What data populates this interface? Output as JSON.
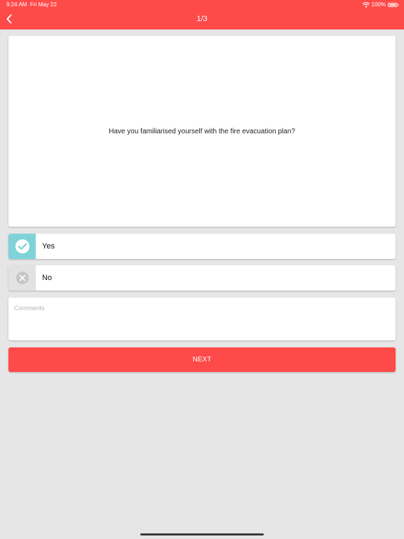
{
  "status_bar": {
    "time": "9:24 AM",
    "date": "Fri May 22",
    "battery": "100%"
  },
  "nav": {
    "title": "1/3",
    "back_icon": "chevron-left-icon"
  },
  "question": {
    "text": "Have you familiarised yourself with the fire evacuation plan?"
  },
  "options": [
    {
      "label": "Yes",
      "icon": "check-circle-icon",
      "selected": true,
      "color": "#7fd3d8"
    },
    {
      "label": "No",
      "icon": "x-circle-icon",
      "selected": false,
      "color": "#e2e2e2"
    }
  ],
  "comments": {
    "placeholder": "Comments",
    "value": ""
  },
  "next_button": {
    "label": "NEXT"
  },
  "colors": {
    "brand": "#ff4a4a",
    "background": "#e6e6e6",
    "selected_accent": "#7fd3d8"
  }
}
